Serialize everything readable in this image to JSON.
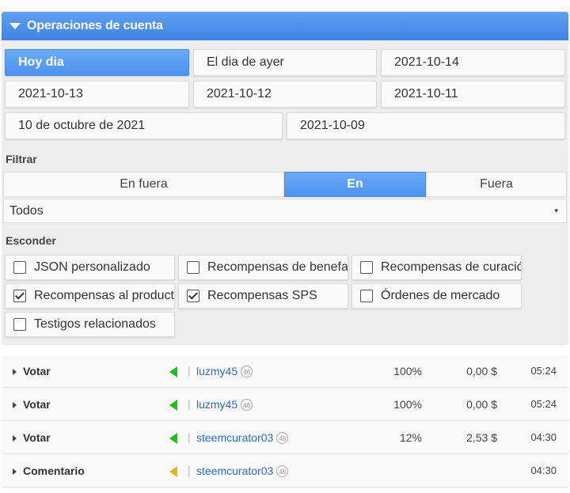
{
  "panel": {
    "title": "Operaciones de cuenta"
  },
  "dates": [
    {
      "label": "Hoy dia",
      "active": true
    },
    {
      "label": "El dia de ayer",
      "active": false
    },
    {
      "label": "2021-10-14",
      "active": false
    },
    {
      "label": "2021-10-13",
      "active": false
    },
    {
      "label": "2021-10-12",
      "active": false
    },
    {
      "label": "2021-10-11",
      "active": false
    },
    {
      "label": "10 de octubre de 2021",
      "active": false
    },
    {
      "label": "2021-10-09",
      "active": false
    }
  ],
  "filter": {
    "label": "Filtrar",
    "segments": [
      {
        "label": "En fuera",
        "active": false
      },
      {
        "label": "En",
        "active": true
      },
      {
        "label": "Fuera",
        "active": false
      }
    ],
    "select_value": "Todos",
    "caret": "▾"
  },
  "hide": {
    "label": "Esconder",
    "options": [
      {
        "label": "JSON personalizado",
        "checked": false
      },
      {
        "label": "Recompensas de benefactor",
        "checked": false
      },
      {
        "label": "Recompensas de curación",
        "checked": false
      },
      {
        "label": "Recompensas al productor",
        "checked": true
      },
      {
        "label": "Recompensas SPS",
        "checked": true
      },
      {
        "label": "Órdenes de mercado",
        "checked": false
      },
      {
        "label": "Testigos relacionados",
        "checked": false
      }
    ]
  },
  "operations": [
    {
      "type": "Votar",
      "direction_color": "#17c417",
      "separator": "|",
      "user": "luzmy45",
      "rep": "46",
      "percent": "100%",
      "amount": "0,00 $",
      "time": "05:24"
    },
    {
      "type": "Votar",
      "direction_color": "#17c417",
      "separator": "|",
      "user": "luzmy45",
      "rep": "46",
      "percent": "100%",
      "amount": "0,00 $",
      "time": "05:24"
    },
    {
      "type": "Votar",
      "direction_color": "#17c417",
      "separator": "|",
      "user": "steemcurator03",
      "rep": "49",
      "percent": "12%",
      "amount": "2,53 $",
      "time": "04:30"
    },
    {
      "type": "Comentario",
      "direction_color": "#e7b514",
      "separator": "|",
      "user": "steemcurator03",
      "rep": "49",
      "percent": "",
      "amount": "",
      "time": "04:30"
    }
  ]
}
